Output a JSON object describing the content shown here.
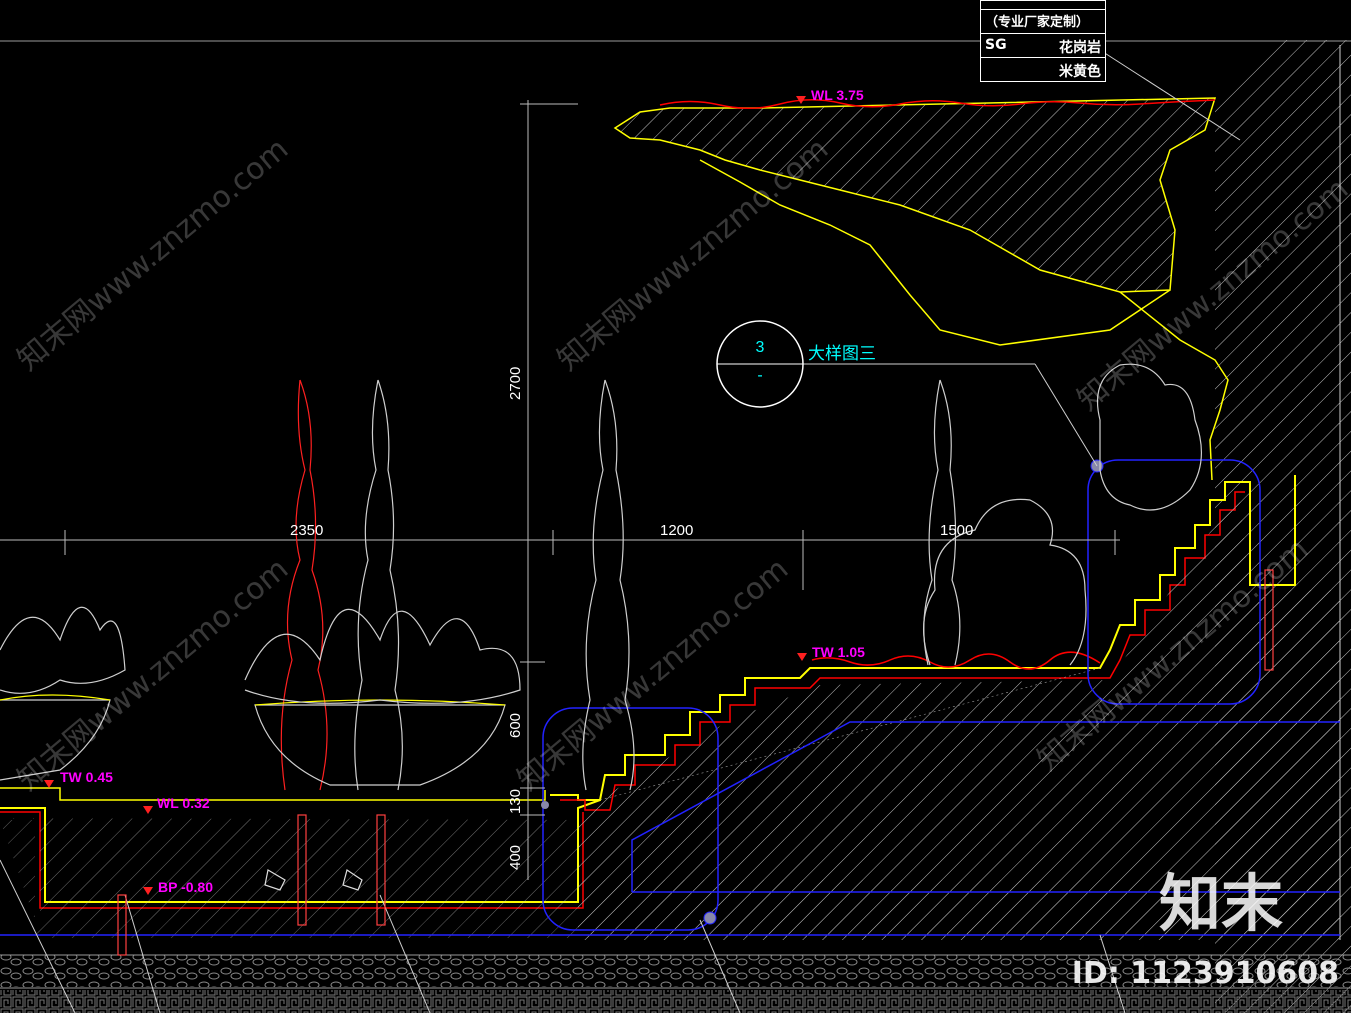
{
  "title_block": {
    "row_note": "（专业厂家定制）",
    "code": "SG",
    "material": "花岗岩",
    "color": "米黄色"
  },
  "levels": {
    "wl_top": "WL 3.75",
    "tw_mid": "TW 1.05",
    "tw_left": "TW 0.45",
    "wl_pool": "WL 0.32",
    "bp": "BP -0.80"
  },
  "dimensions": {
    "d2350": "2350",
    "d1200": "1200",
    "d1500": "1500",
    "d2700": "2700",
    "d600": "600",
    "d130": "130",
    "d400": "400"
  },
  "callout": {
    "number": "3",
    "sheet": "-",
    "label": "大样图三"
  },
  "watermark": {
    "text": "知末网www.znzmo.com",
    "brand": "知末",
    "id": "ID: 1123910608"
  },
  "colors": {
    "background": "#000000",
    "rock_outline": "#ffff00",
    "water_line": "#ff0000",
    "level_text": "#ff00ff",
    "callout": "#00ffff",
    "detail_box": "#0000ff",
    "dimension": "#ffffff"
  }
}
